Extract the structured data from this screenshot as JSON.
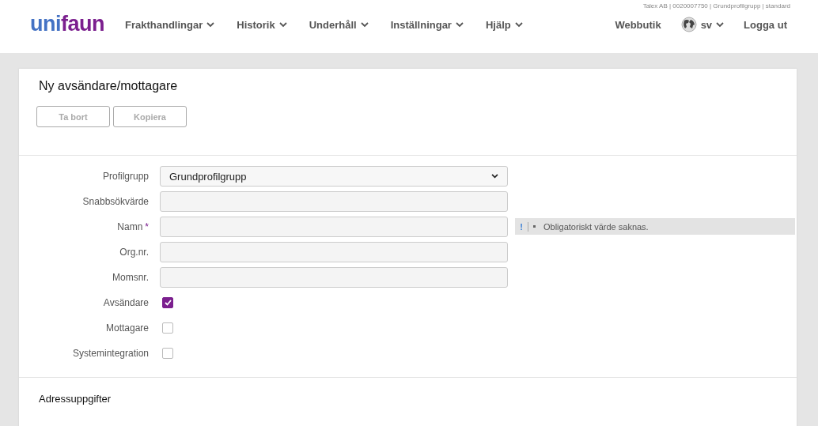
{
  "header": {
    "logo": {
      "first": "uni",
      "second": "faun"
    },
    "account_info": "Talex AB | 0020007750 | Grundprofilgrupp | standard",
    "nav": [
      {
        "label": "Frakthandlingar"
      },
      {
        "label": "Historik"
      },
      {
        "label": "Underhåll"
      },
      {
        "label": "Inställningar"
      },
      {
        "label": "Hjälp"
      }
    ],
    "webshop": "Webbutik",
    "language": "sv",
    "logout": "Logga ut"
  },
  "page": {
    "title": "Ny avsändare/mottagare",
    "buttons": [
      {
        "label": "Ta bort",
        "disabled": true
      },
      {
        "label": "Kopiera",
        "disabled": true
      }
    ]
  },
  "required_marker": "*",
  "form": [
    {
      "kind": "select",
      "label": "Profilgrupp",
      "value": "Grundprofilgrupp",
      "required": false
    },
    {
      "kind": "text",
      "label": "Snabbsökvärde",
      "required": false
    },
    {
      "kind": "text",
      "label": "Namn",
      "required": true,
      "error": {
        "icon": "!",
        "message": "Obligatoriskt värde saknas."
      }
    },
    {
      "kind": "text",
      "label": "Org.nr.",
      "required": false
    },
    {
      "kind": "text",
      "label": "Momsnr.",
      "required": false
    },
    {
      "kind": "checkbox",
      "label": "Avsändare",
      "checked": true
    },
    {
      "kind": "checkbox",
      "label": "Mottagare",
      "checked": false
    },
    {
      "kind": "checkbox",
      "label": "Systemintegration",
      "checked": false
    }
  ],
  "section": {
    "title": "Adressuppgifter"
  }
}
